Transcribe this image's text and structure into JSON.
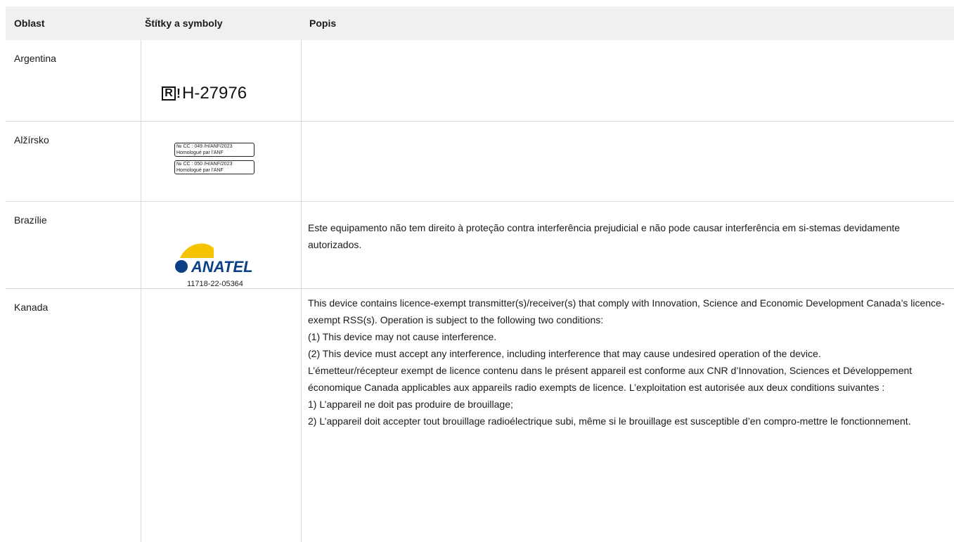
{
  "table": {
    "headers": {
      "region": "Oblast",
      "labels": "Štítky a symboly",
      "description": "Popis"
    },
    "rows": [
      {
        "region": "Argentina",
        "label_prefix": "R",
        "label_mark": "!",
        "label_number": "H-27976",
        "description": []
      },
      {
        "region": "Alžírsko",
        "labels": [
          {
            "line1": "№ CC : 049 /H/ANF/2023",
            "line2": "Homologué par l'ANF"
          },
          {
            "line1": "№ CC : 050 /H/ANF/2023",
            "line2": "Homologué par l'ANF"
          }
        ],
        "description": []
      },
      {
        "region": "Brazílie",
        "logo_text": "ANATEL",
        "label_number": "11718-22-05364",
        "description": [
          "Este equipamento não tem direito à proteção contra interferência prejudicial e não pode causar interferência em si-stemas devidamente autorizados."
        ]
      },
      {
        "region": "Kanada",
        "description": [
          "This device contains licence-exempt transmitter(s)/receiver(s) that comply with Innovation, Science and Economic Development Canada’s licence-exempt RSS(s). Operation is subject to the following two conditions:",
          "(1) This device may not cause interference.",
          "(2) This device must accept any interference, including interference that may cause undesired operation of the device.",
          "L’émetteur/récepteur exempt de licence contenu dans le présent appareil est conforme aux CNR d’Innovation, Sciences et Développement économique Canada applicables aux appareils radio exempts de licence. L’exploitation est autorisée aux deux conditions suivantes :",
          "1) L’appareil ne doit pas produire de brouillage;",
          "2) L’appareil doit accepter tout brouillage radioélectrique subi, même si le brouillage est susceptible d’en compro-mettre le fonctionnement."
        ]
      }
    ]
  },
  "colors": {
    "header_bg": "#f0f0f0",
    "grid": "#d9d9d9",
    "text": "#1a1a1a",
    "anatel_blue": "#0b3f86",
    "anatel_yellow": "#f5c400"
  }
}
